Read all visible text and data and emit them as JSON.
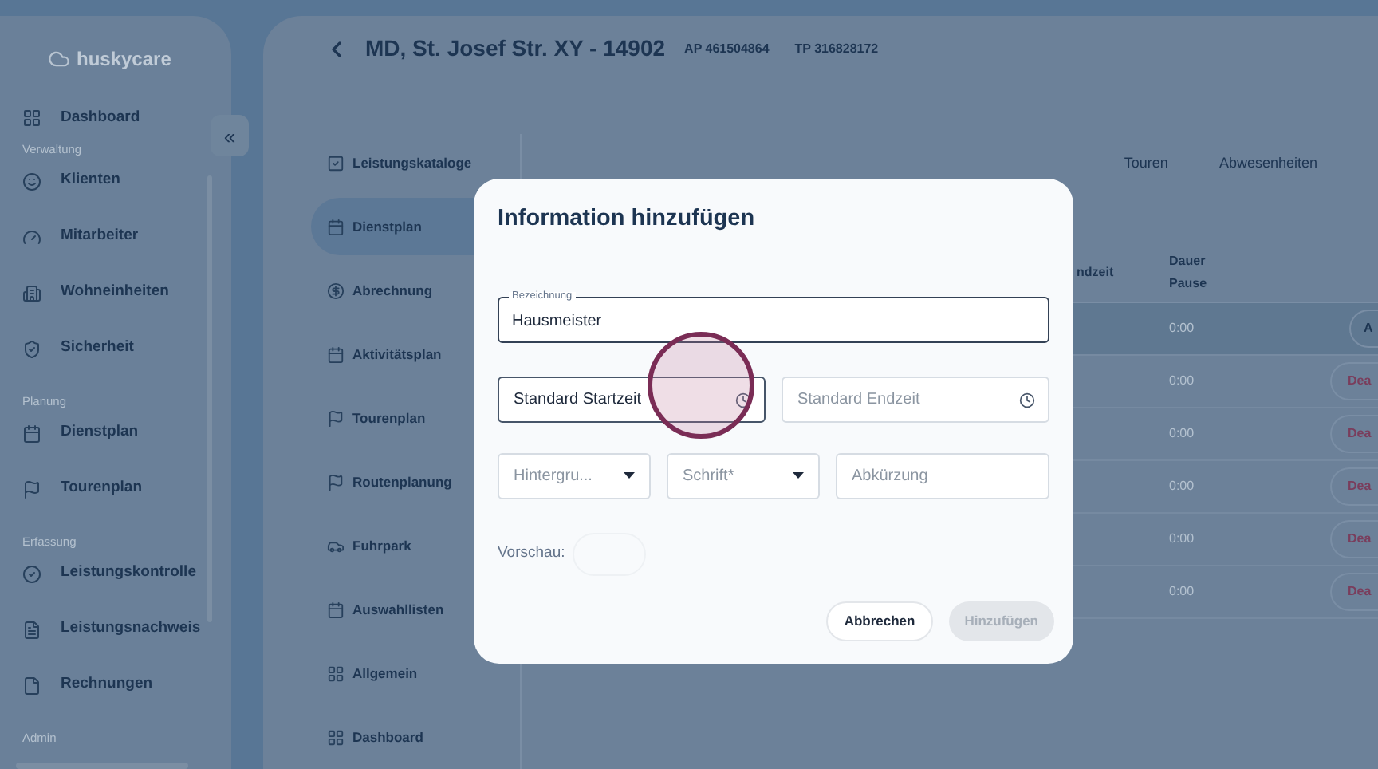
{
  "sidebar": {
    "logo": "huskycare",
    "collapse_button": "«",
    "top_item": {
      "label": "Dashboard"
    },
    "sections": [
      {
        "title": "Verwaltung",
        "items": [
          {
            "label": "Klienten"
          },
          {
            "label": "Mitarbeiter"
          },
          {
            "label": "Wohneinheiten"
          },
          {
            "label": "Sicherheit"
          }
        ]
      },
      {
        "title": "Planung",
        "items": [
          {
            "label": "Dienstplan"
          },
          {
            "label": "Tourenplan"
          }
        ]
      },
      {
        "title": "Erfassung",
        "items": [
          {
            "label": "Leistungskontrolle"
          },
          {
            "label": "Leistungsnachweis"
          },
          {
            "label": "Rechnungen"
          }
        ]
      },
      {
        "title": "Admin"
      }
    ]
  },
  "header": {
    "title": "MD, St. Josef Str. XY - 14902",
    "codes": [
      "AP 461504864",
      "TP 316828172"
    ]
  },
  "subnav": [
    {
      "label": "Leistungskataloge",
      "selected": false
    },
    {
      "label": "Dienstplan",
      "selected": true
    },
    {
      "label": "Abrechnung",
      "selected": false
    },
    {
      "label": "Aktivitätsplan",
      "selected": false
    },
    {
      "label": "Tourenplan",
      "selected": false
    },
    {
      "label": "Routenplanung",
      "selected": false
    },
    {
      "label": "Fuhrpark",
      "selected": false
    },
    {
      "label": "Auswahllisten",
      "selected": false
    },
    {
      "label": "Allgemein",
      "selected": false
    },
    {
      "label": "Dashboard",
      "selected": false
    }
  ],
  "tabs": [
    {
      "label": "Touren",
      "selected": false
    },
    {
      "label": "Abwesenheiten",
      "selected": false
    }
  ],
  "table": {
    "columns": [
      "ndzeit",
      "Dauer Pause"
    ],
    "rows": [
      {
        "selected": true,
        "pause": "0:00",
        "action": {
          "label": "A",
          "kind": "neutral"
        }
      },
      {
        "selected": false,
        "pause": "0:00",
        "action": {
          "label": "Dea",
          "kind": "deactivate"
        }
      },
      {
        "selected": false,
        "pause": "0:00",
        "action": {
          "label": "Dea",
          "kind": "deactivate"
        }
      },
      {
        "selected": false,
        "pause": "0:00",
        "action": {
          "label": "Dea",
          "kind": "deactivate"
        }
      },
      {
        "selected": false,
        "pause": "0:00",
        "action": {
          "label": "Dea",
          "kind": "deactivate"
        }
      },
      {
        "selected": false,
        "pause": "0:00",
        "action": {
          "label": "Dea",
          "kind": "deactivate"
        }
      }
    ]
  },
  "dialog": {
    "title": "Information hinzufügen",
    "name_field": {
      "label": "Bezeichnung",
      "value": "Hausmeister"
    },
    "time_fields": [
      {
        "placeholder": "Standard Startzeit",
        "highlighted": true
      },
      {
        "placeholder": "Standard Endzeit",
        "highlighted": false
      }
    ],
    "selects": [
      {
        "placeholder": "Hintergru..."
      },
      {
        "placeholder": "Schrift*"
      }
    ],
    "abbreviation": {
      "placeholder": "Abkürzung"
    },
    "preview_label": "Vorschau:",
    "buttons": [
      {
        "label": "Abbrechen",
        "disabled": false
      },
      {
        "label": "Hinzufügen",
        "disabled": true
      }
    ]
  }
}
